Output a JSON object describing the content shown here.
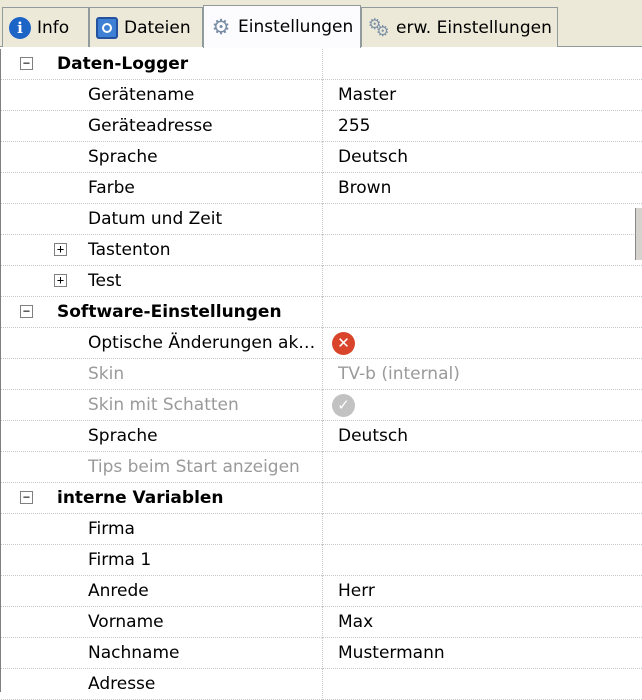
{
  "tabs": [
    {
      "label": "Info",
      "icon": "info-icon"
    },
    {
      "label": "Dateien",
      "icon": "files-icon"
    },
    {
      "label": "Einstellungen",
      "icon": "gear-icon",
      "active": true
    },
    {
      "label": "erw. Einstellungen",
      "icon": "gears-icon"
    }
  ],
  "grid": {
    "rows": [
      {
        "kind": "category",
        "label": "Daten-Logger",
        "expander": "−"
      },
      {
        "kind": "property",
        "label": "Gerätename",
        "value": "Master"
      },
      {
        "kind": "property",
        "label": "Geräteadresse",
        "value": "255"
      },
      {
        "kind": "property",
        "label": "Sprache",
        "value": "Deutsch"
      },
      {
        "kind": "property",
        "label": "Farbe",
        "value": "Brown"
      },
      {
        "kind": "property",
        "label": "Datum und Zeit",
        "value": ""
      },
      {
        "kind": "subcategory",
        "label": "Tastenton",
        "expander": "+"
      },
      {
        "kind": "subcategory",
        "label": "Test",
        "expander": "+"
      },
      {
        "kind": "category",
        "label": "Software-Einstellungen",
        "expander": "−"
      },
      {
        "kind": "property",
        "label": "Optische Änderungen ak…",
        "value": "",
        "icon": "red-x-icon",
        "iconColor": "#d9452b"
      },
      {
        "kind": "property",
        "label": "Skin",
        "value": "TV-b (internal)",
        "disabled": true
      },
      {
        "kind": "property",
        "label": "Skin mit Schatten",
        "value": "",
        "icon": "grey-check-icon",
        "iconColor": "#c2c2c2",
        "disabled": true
      },
      {
        "kind": "property",
        "label": "Sprache",
        "value": "Deutsch"
      },
      {
        "kind": "property",
        "label": "Tips beim Start anzeigen",
        "value": "",
        "disabled": true
      },
      {
        "kind": "category",
        "label": "interne Variablen",
        "expander": "−"
      },
      {
        "kind": "property",
        "label": "Firma",
        "value": ""
      },
      {
        "kind": "property",
        "label": "Firma 1",
        "value": ""
      },
      {
        "kind": "property",
        "label": "Anrede",
        "value": "Herr"
      },
      {
        "kind": "property",
        "label": "Vorname",
        "value": "Max"
      },
      {
        "kind": "property",
        "label": "Nachname",
        "value": "Mustermann"
      },
      {
        "kind": "property",
        "label": "Adresse",
        "value": ""
      }
    ]
  },
  "colors": {
    "tabbar_bg": "#ece9d8",
    "active_tab_bg": "#fcfcfe",
    "disabled_text": "#9a9a9a",
    "error_icon": "#d9452b"
  }
}
